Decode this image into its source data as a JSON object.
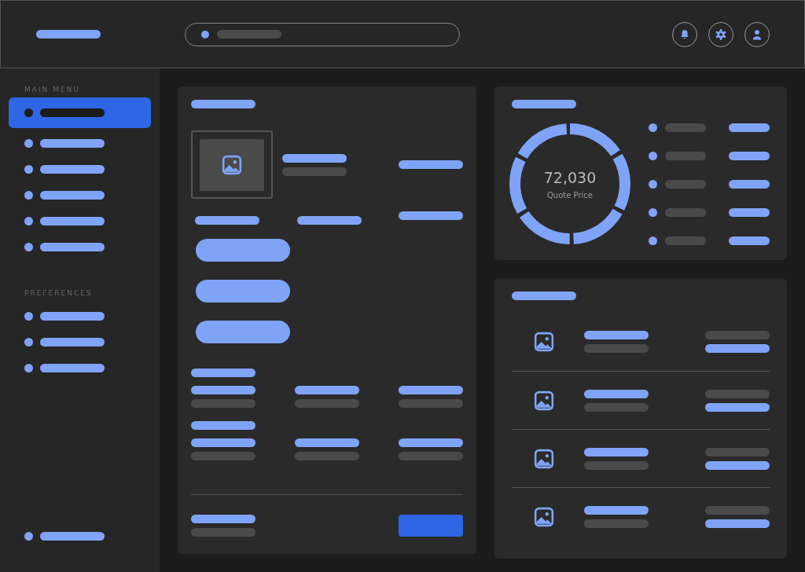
{
  "sidebar": {
    "sections": [
      {
        "heading": "MAIN MENU",
        "items": [
          {
            "selected": true
          },
          {
            "selected": false
          },
          {
            "selected": false
          },
          {
            "selected": false
          },
          {
            "selected": false
          },
          {
            "selected": false
          }
        ]
      },
      {
        "heading": "PREFERENCES",
        "items": [
          {
            "selected": false
          },
          {
            "selected": false
          },
          {
            "selected": false
          }
        ]
      }
    ],
    "bottom_items": [
      {
        "selected": false
      }
    ]
  },
  "summary": {
    "value": "72,030",
    "label": "Quote Price"
  }
}
